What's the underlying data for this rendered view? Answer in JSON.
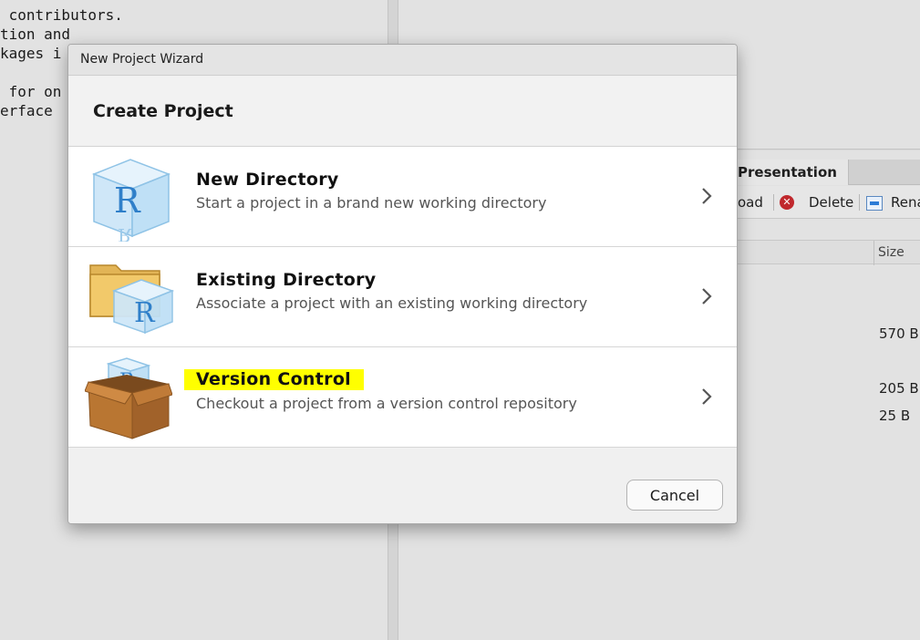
{
  "console": {
    "lines": [
      " contributors.",
      "tion and",
      "kages i",
      "",
      " for on",
      "erface"
    ]
  },
  "files_pane": {
    "tab_label": "Presentation",
    "toolbar": {
      "upload_partial": "oad",
      "delete_label": "Delete",
      "rename_partial": "Rena"
    },
    "size_header": "Size",
    "sizes": [
      "570 B",
      "205 B",
      "25 B"
    ]
  },
  "dialog": {
    "window_title": "New Project Wizard",
    "heading": "Create Project",
    "options": [
      {
        "title": "New Directory",
        "description": "Start a project in a brand new working directory",
        "icon": "r-cube-icon"
      },
      {
        "title": "Existing Directory",
        "description": "Associate a project with an existing working directory",
        "icon": "folder-r-cube-icon"
      },
      {
        "title": "Version Control",
        "description": "Checkout a project from a version control repository",
        "icon": "box-r-cube-icon",
        "highlight_color": "#ffff00"
      }
    ],
    "cancel_label": "Cancel"
  },
  "colors": {
    "highlight": "#ffff00",
    "delete_icon": "#c0282d",
    "r_blue": "#2f7fc9"
  }
}
